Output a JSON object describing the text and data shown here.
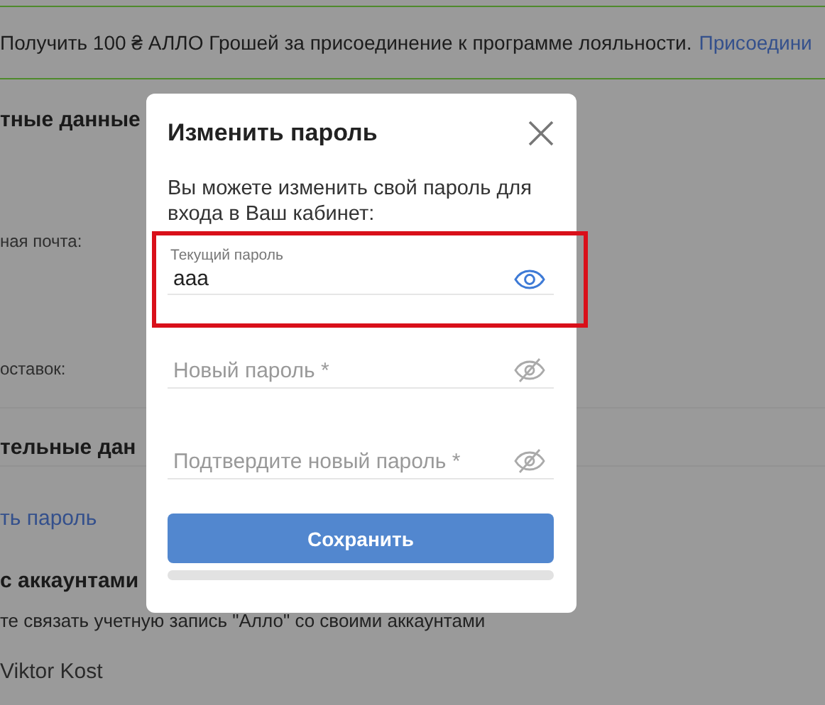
{
  "banner": {
    "text": "Получить 100 ₴ АЛЛО Грошей за присоединение к программе лояльности.",
    "link": "Присоедини"
  },
  "page": {
    "heading_1": "тные данные",
    "email_label": "ная почта:",
    "delivery_label": "оставок:",
    "heading_2": "тельные дан",
    "links": [
      "ть пароль"
    ],
    "heading_3": "с аккаунтами",
    "description": "те связать учетную запись \"Алло\" со своими аккаунтами",
    "account_name": "Viktor Kost"
  },
  "dialog": {
    "title": "Изменить пароль",
    "intro": "Вы можете изменить свой пароль для входа в Ваш кабинет:",
    "fields": [
      {
        "label": "Текущий пароль",
        "value": "aaa",
        "visible": true,
        "highlighted": true
      },
      {
        "placeholder": "Новый пароль *",
        "visible": false,
        "highlighted": false
      },
      {
        "placeholder": "Подтвердите новый пароль *",
        "visible": false,
        "highlighted": false
      }
    ],
    "button": "Сохранить"
  }
}
